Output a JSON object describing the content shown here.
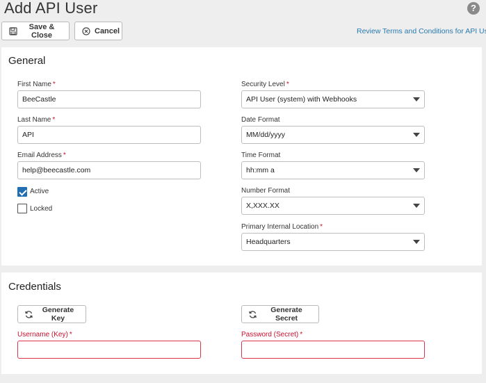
{
  "page": {
    "title": "Add API User"
  },
  "toolbar": {
    "save_label": "Save & Close",
    "cancel_label": "Cancel",
    "terms_link": "Review Terms and Conditions for API Use"
  },
  "general": {
    "title": "General",
    "first_name": {
      "label": "First Name",
      "value": "BeeCastle"
    },
    "last_name": {
      "label": "Last Name",
      "value": "API"
    },
    "email": {
      "label": "Email Address",
      "value": "help@beecastle.com"
    },
    "active": {
      "label": "Active",
      "checked": true
    },
    "locked": {
      "label": "Locked",
      "checked": false
    },
    "security_level": {
      "label": "Security Level",
      "value": "API User (system) with Webhooks"
    },
    "date_format": {
      "label": "Date Format",
      "value": "MM/dd/yyyy"
    },
    "time_format": {
      "label": "Time Format",
      "value": "hh:mm a"
    },
    "number_format": {
      "label": "Number Format",
      "value": "X,XXX.XX"
    },
    "primary_location": {
      "label": "Primary Internal Location",
      "value": "Headquarters"
    }
  },
  "credentials": {
    "title": "Credentials",
    "generate_key_label": "Generate Key",
    "generate_secret_label": "Generate Secret",
    "username": {
      "label": "Username (Key)",
      "value": ""
    },
    "password": {
      "label": "Password (Secret)",
      "value": ""
    }
  },
  "required_mark": "*",
  "help_glyph": "?",
  "colors": {
    "accent": "#1f6fb2",
    "link": "#2a7ab0",
    "required": "#c8102e",
    "error_border": "#d9344a"
  }
}
